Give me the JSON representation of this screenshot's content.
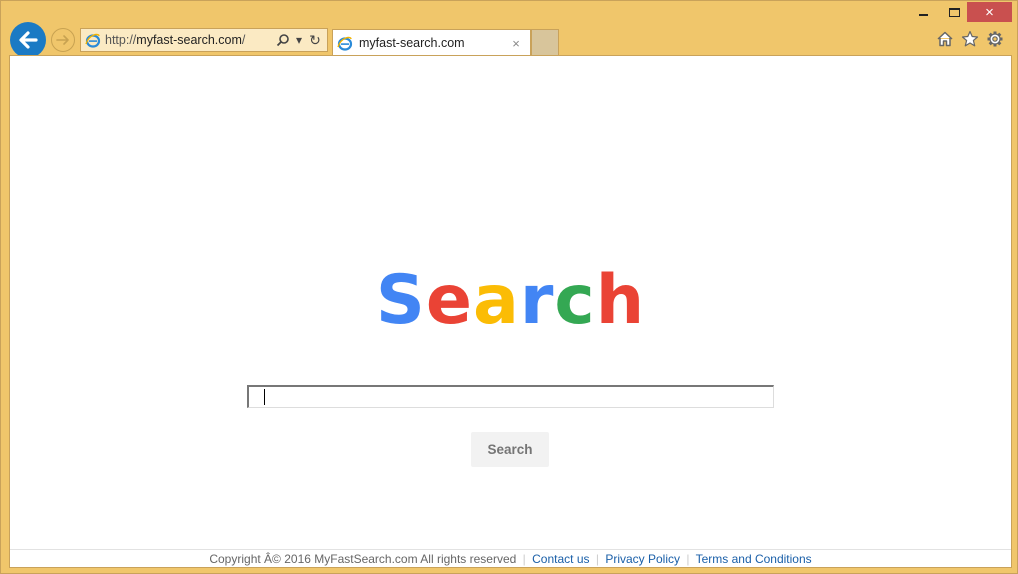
{
  "window": {
    "caption": {
      "minimize": "minimize",
      "maximize": "maximize",
      "close": "×"
    }
  },
  "nav": {
    "back_icon": "back-arrow-icon",
    "forward_icon": "forward-arrow-icon"
  },
  "address_bar": {
    "prefix": "http://",
    "host": "myfast-search.com",
    "suffix": "/",
    "search_icon": "⌕",
    "dropdown_icon": "▾",
    "refresh_icon": "↻"
  },
  "tabs": [
    {
      "title": "myfast-search.com",
      "close": "×",
      "active": true
    }
  ],
  "toolbar": {
    "icons": [
      "home-icon",
      "star-icon",
      "gear-icon"
    ]
  },
  "page": {
    "logo": {
      "letters": [
        {
          "char": "S",
          "color": "#4285f4"
        },
        {
          "char": "e",
          "color": "#ea4335"
        },
        {
          "char": "a",
          "color": "#fbbc05"
        },
        {
          "char": "r",
          "color": "#4285f4"
        },
        {
          "char": "c",
          "color": "#34a853"
        },
        {
          "char": "h",
          "color": "#ea4335"
        }
      ]
    },
    "search_input": {
      "value": "",
      "placeholder": ""
    },
    "search_button": "Search",
    "footer": {
      "copyright": "Copyright Â© 2016 MyFastSearch.com All rights reserved",
      "links": [
        "Contact us",
        "Privacy Policy",
        "Terms and Conditions"
      ],
      "separator": "|"
    }
  },
  "colors": {
    "frame": "#f0c66b",
    "close_button": "#c9504f",
    "back_button": "#1b7ac4",
    "link": "#1a5fa8"
  }
}
